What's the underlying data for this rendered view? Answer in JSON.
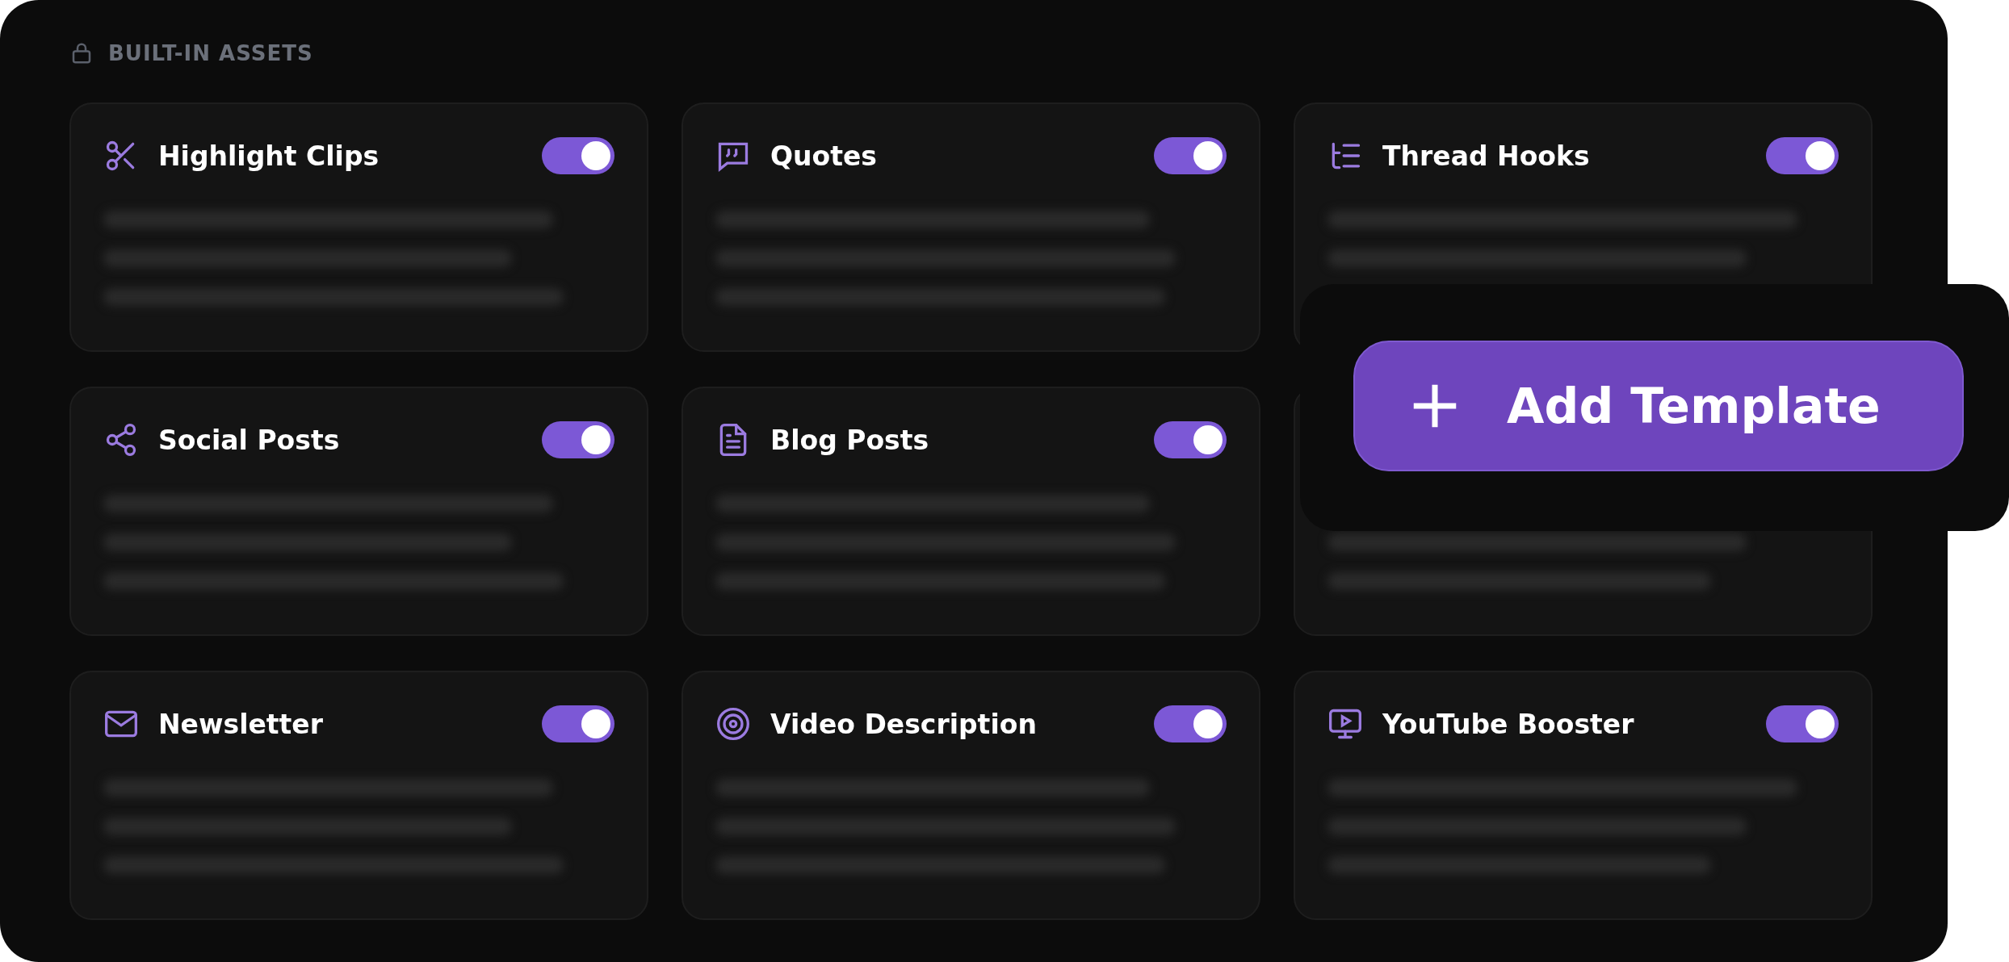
{
  "section": {
    "title": "BUILT-IN ASSETS"
  },
  "templates": [
    {
      "kind": "template",
      "title": "Highlight Clips",
      "enabled": true
    },
    {
      "kind": "template",
      "title": "Quotes",
      "enabled": true
    },
    {
      "kind": "template",
      "title": "Thread Hooks",
      "enabled": true
    },
    {
      "kind": "template",
      "title": "Social Posts",
      "enabled": true
    },
    {
      "kind": "template",
      "title": "Blog Posts",
      "enabled": true
    },
    {
      "kind": "covered"
    },
    {
      "kind": "template",
      "title": "Newsletter",
      "enabled": true
    },
    {
      "kind": "template",
      "title": "Video Description",
      "enabled": true
    },
    {
      "kind": "template",
      "title": "YouTube Booster",
      "enabled": true
    }
  ],
  "add_button": {
    "label": "Add Template"
  }
}
